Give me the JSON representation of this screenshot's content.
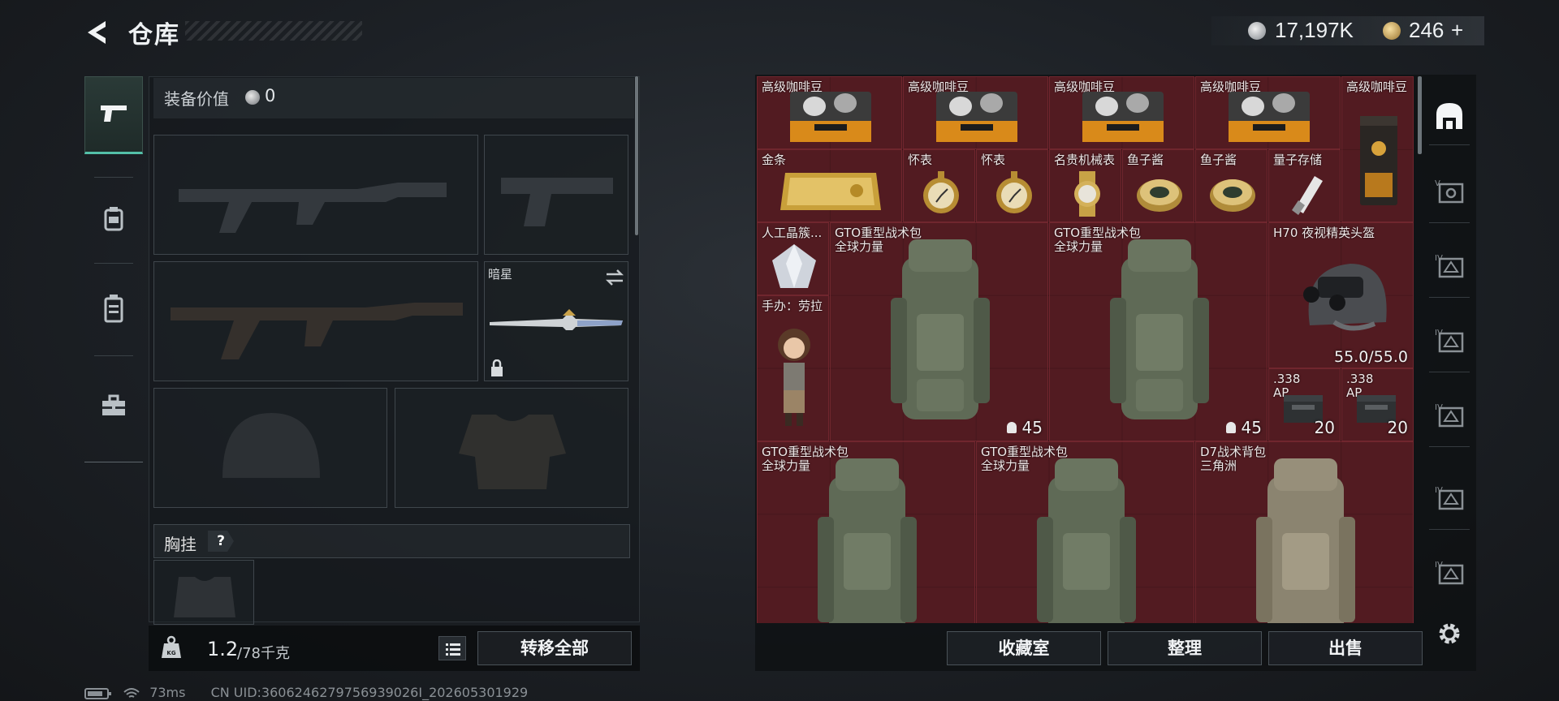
{
  "header": {
    "title": "仓库",
    "currency_silver": "17,197K",
    "currency_gold": "246",
    "currency_gold_plus": "+"
  },
  "category_nav": {
    "items": [
      {
        "name": "weapons",
        "icon": "pistol-icon",
        "active": true
      },
      {
        "name": "armor",
        "icon": "helmet-icon",
        "active": false
      },
      {
        "name": "rigs",
        "icon": "vest-icon",
        "active": false
      },
      {
        "name": "items",
        "icon": "toolbox-icon",
        "active": false
      }
    ]
  },
  "loadout": {
    "equip_value_label": "装备价值",
    "equip_value": "0",
    "knife_label": "暗星",
    "chest_label": "胸挂",
    "chest_help": "?"
  },
  "footer_left": {
    "weight_current": "1.2",
    "weight_max": "/78千克",
    "transfer_all": "转移全部"
  },
  "storage": {
    "items": [
      {
        "name": "高级咖啡豆"
      },
      {
        "name": "高级咖啡豆"
      },
      {
        "name": "高级咖啡豆"
      },
      {
        "name": "高级咖啡豆"
      },
      {
        "name": "高级咖啡豆"
      },
      {
        "name": "金条"
      },
      {
        "name": "怀表"
      },
      {
        "name": "怀表"
      },
      {
        "name": "名贵机械表"
      },
      {
        "name": "鱼子酱"
      },
      {
        "name": "鱼子酱"
      },
      {
        "name": "量子存储"
      },
      {
        "name": "人工晶簇..."
      },
      {
        "name": "手办：劳拉"
      },
      {
        "name": "GTO重型战术包",
        "sub": "全球力量",
        "qty": "45"
      },
      {
        "name": "GTO重型战术包",
        "sub": "全球力量",
        "qty": "45"
      },
      {
        "name": "H70 夜视精英头盔",
        "durability": "55.0/55.0"
      },
      {
        "name": ".338",
        "sub": "AP",
        "qty": "20"
      },
      {
        "name": ".338",
        "sub": "AP",
        "qty": "20"
      },
      {
        "name": "GTO重型战术包",
        "sub": "全球力量"
      },
      {
        "name": "GTO重型战术包",
        "sub": "全球力量"
      },
      {
        "name": "D7战术背包",
        "sub": "三角洲"
      }
    ],
    "buttons": {
      "collection": "收藏室",
      "sort": "整理",
      "sell": "出售"
    }
  },
  "status_bar": {
    "ping": "73ms",
    "uid": "CN UID:3606246279756939026I_202605301929"
  },
  "colors": {
    "accent": "#53c0a8",
    "grid_bg": "#4f1b21",
    "panel_bg": "#161a1e"
  }
}
